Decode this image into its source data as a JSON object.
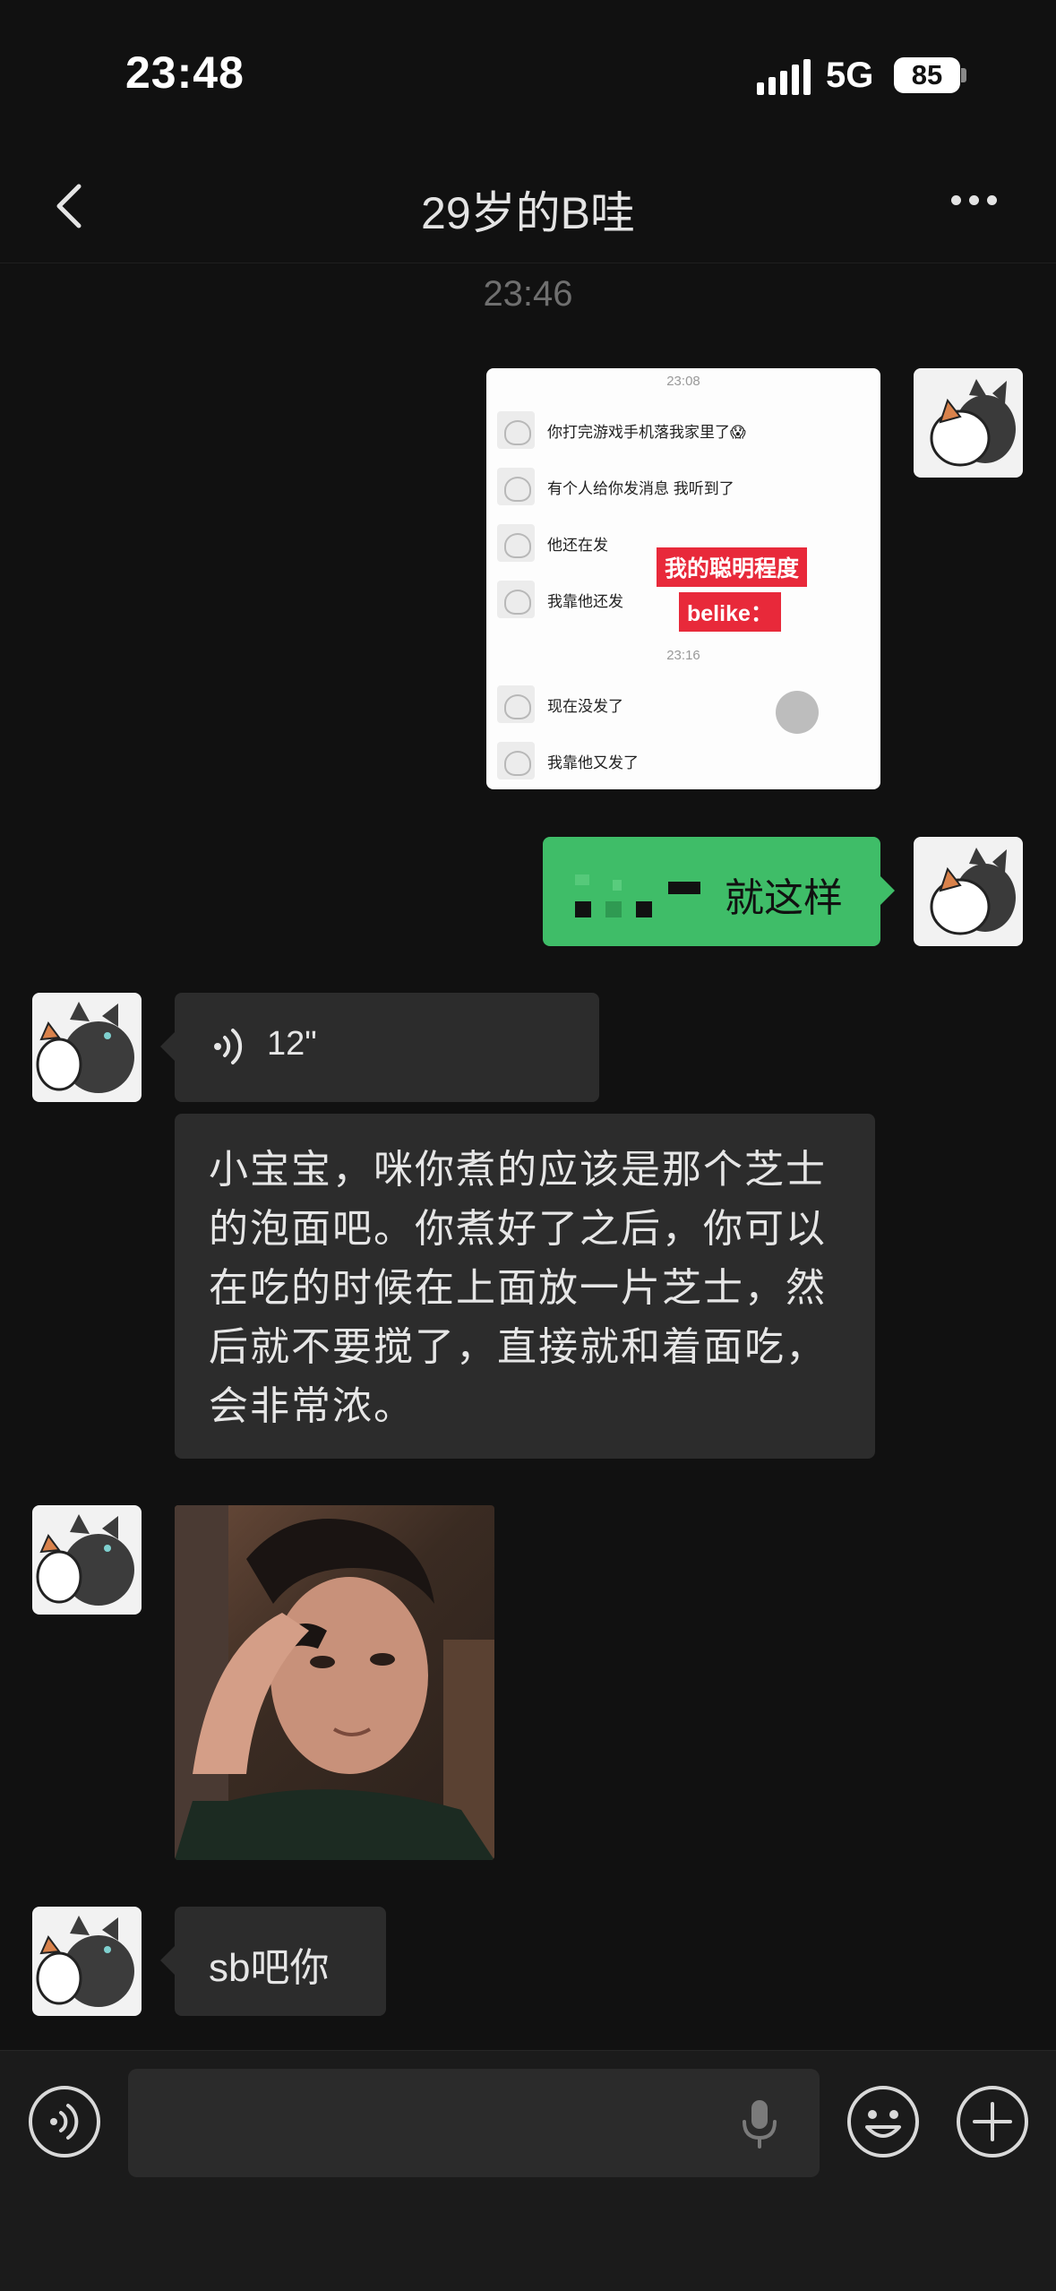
{
  "status_bar": {
    "time": "23:48",
    "network": "5G",
    "battery": "85"
  },
  "nav": {
    "back_icon": "chevron-left-icon",
    "title": "29岁的B哇",
    "more_icon": "ellipsis-icon"
  },
  "chat": {
    "timestamp": "23:46",
    "screenshot_message": {
      "rows": [
        {
          "text": "你打完游戏手机落我家里了😱"
        },
        {
          "text": "有个人给你发消息 我听到了"
        },
        {
          "text": "他还在发"
        },
        {
          "text": "我靠他还发"
        },
        {
          "text": "现在没发了"
        },
        {
          "text": "我靠他又发了"
        }
      ],
      "time_1": "23:08",
      "time_2": "23:16",
      "overlay_1": "我的聪明程度",
      "overlay_2": "belike："
    },
    "sent_text": "就这样",
    "voice_message": {
      "duration": "12\""
    },
    "long_message": "小宝宝，咪你煮的应该是那个芝士的泡面吧。你煮好了之后，你可以在吃的时候在上面放一片芝士，然后就不要搅了，直接就和着面吃，会非常浓。",
    "last_message": "sb吧你"
  },
  "input_bar": {
    "voice_icon": "voice-toggle-icon",
    "mic_icon": "microphone-icon",
    "emoji_icon": "emoji-icon",
    "plus_icon": "plus-icon"
  },
  "colors": {
    "background": "#111111",
    "sent_bubble": "#3fbd68",
    "received_bubble": "#2c2c2c"
  }
}
